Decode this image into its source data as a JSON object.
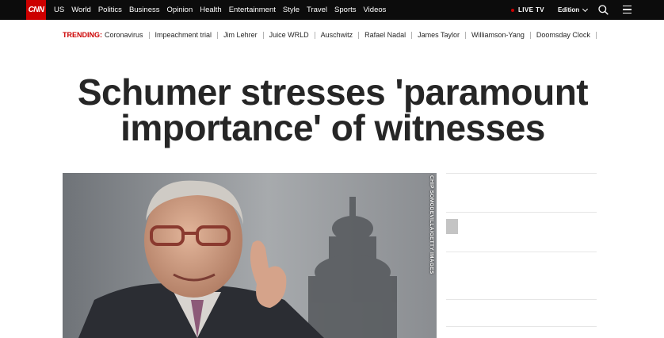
{
  "brand": {
    "logo_text": "CNN",
    "color": "#cc0000"
  },
  "nav": {
    "items": [
      "US",
      "World",
      "Politics",
      "Business",
      "Opinion",
      "Health",
      "Entertainment",
      "Style",
      "Travel",
      "Sports",
      "Videos"
    ],
    "live_tv": "LIVE TV",
    "edition": "Edition"
  },
  "trending": {
    "label": "TRENDING:",
    "items": [
      "Coronavirus",
      "Impeachment trial",
      "Jim Lehrer",
      "Juice WRLD",
      "Auschwitz",
      "Rafael Nadal",
      "James Taylor",
      "Williamson-Yang",
      "Doomsday Clock"
    ]
  },
  "article": {
    "headline": "Schumer stresses 'paramount importance' of witnesses",
    "image_credit": "CHIP SOMODEVILLA/GETTY IMAGES"
  }
}
